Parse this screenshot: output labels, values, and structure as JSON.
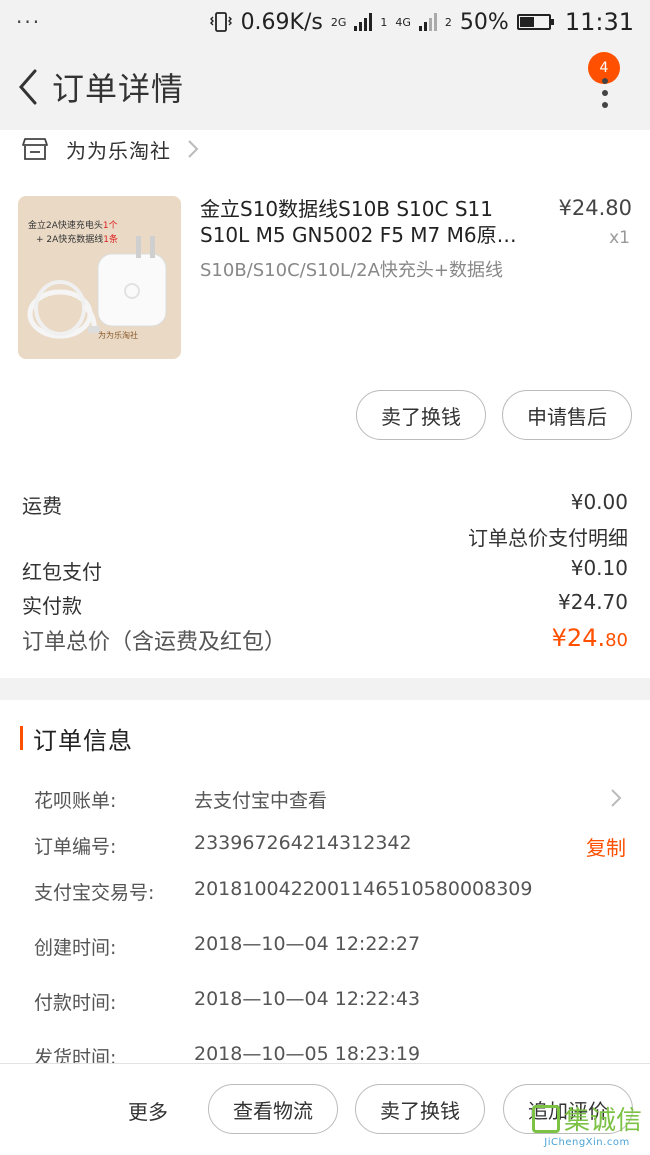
{
  "status_bar": {
    "dots": "···",
    "speed": "0.69K/s",
    "net1": "2G",
    "net1_slot": "1",
    "net2": "4G",
    "net2_slot": "2",
    "battery": "50%",
    "battery_level": 0.5,
    "time": "11:31"
  },
  "header": {
    "title": "订单详情",
    "badge": "4"
  },
  "shop": {
    "name": "为为乐淘社"
  },
  "product": {
    "title": "金立S10数据线S10B S10C S11 S10L M5 GN5002 F5 M7 M6原…",
    "spec": "S10B/S10C/S10L/2A快充头+数据线",
    "price": "¥24.80",
    "qty": "x1",
    "image_text": {
      "line1_a": "金立2A快速充电头",
      "line1_b": "1个",
      "line2_a": "+ 2A快充数据线",
      "line2_b": "1条",
      "brand": "为为乐淘社"
    }
  },
  "actions": {
    "sell_swap": "卖了换钱",
    "after_sale": "申请售后"
  },
  "costs": {
    "shipping_label": "运费",
    "shipping_value": "¥0.00",
    "detail_link": "订单总价支付明细",
    "redpacket_label": "红包支付",
    "redpacket_value": "¥0.10",
    "paid_label": "实付款",
    "paid_value": "¥24.70",
    "total_label": "订单总价（含运费及红包）",
    "total_value_main": "¥24.",
    "total_value_cents": "80"
  },
  "order_info": {
    "heading": "订单信息",
    "rows": [
      {
        "label": "花呗账单:",
        "value": "去支付宝中查看"
      },
      {
        "label": "订单编号:",
        "value": "233967264214312342",
        "action": "复制"
      },
      {
        "label": "支付宝交易号:",
        "value": "2018100422001146510580008309"
      },
      {
        "label": "创建时间:",
        "value": "2018—10—04 12:22:27"
      },
      {
        "label": "付款时间:",
        "value": "2018—10—04 12:22:43"
      },
      {
        "label": "发货时间:",
        "value": "2018—10—05 18:23:19"
      }
    ]
  },
  "bottom_bar": {
    "more": "更多",
    "logistics": "查看物流",
    "sell_swap": "卖了换钱",
    "add_review": "追加评价"
  },
  "watermark": {
    "text": "集诚信",
    "url": "JiChengXin.com"
  },
  "colors": {
    "accent": "#ff5000",
    "background_gray": "#f2f2f2"
  }
}
